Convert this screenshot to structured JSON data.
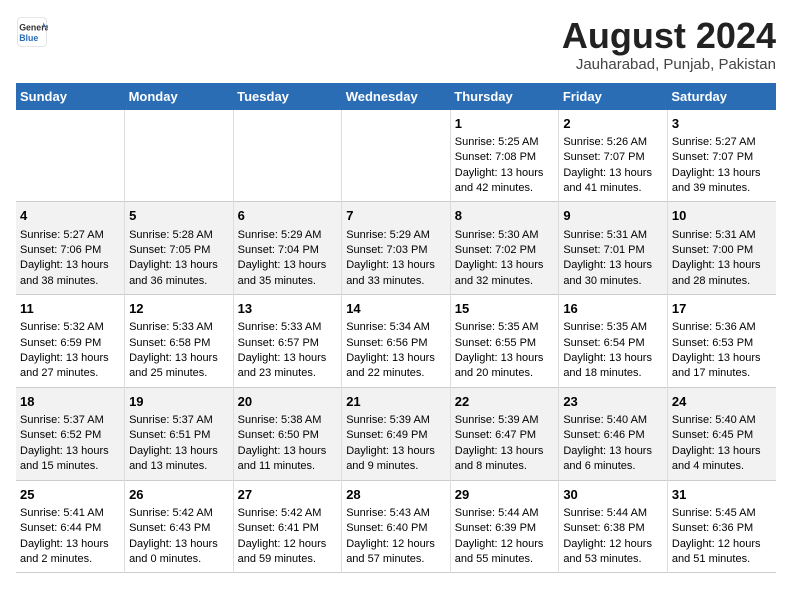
{
  "header": {
    "logo_line1": "General",
    "logo_line2": "Blue",
    "month_title": "August 2024",
    "subtitle": "Jauharabad, Punjab, Pakistan"
  },
  "days_of_week": [
    "Sunday",
    "Monday",
    "Tuesday",
    "Wednesday",
    "Thursday",
    "Friday",
    "Saturday"
  ],
  "weeks": [
    [
      {
        "day": "",
        "lines": []
      },
      {
        "day": "",
        "lines": []
      },
      {
        "day": "",
        "lines": []
      },
      {
        "day": "",
        "lines": []
      },
      {
        "day": "1",
        "lines": [
          "Sunrise: 5:25 AM",
          "Sunset: 7:08 PM",
          "Daylight: 13 hours",
          "and 42 minutes."
        ]
      },
      {
        "day": "2",
        "lines": [
          "Sunrise: 5:26 AM",
          "Sunset: 7:07 PM",
          "Daylight: 13 hours",
          "and 41 minutes."
        ]
      },
      {
        "day": "3",
        "lines": [
          "Sunrise: 5:27 AM",
          "Sunset: 7:07 PM",
          "Daylight: 13 hours",
          "and 39 minutes."
        ]
      }
    ],
    [
      {
        "day": "4",
        "lines": [
          "Sunrise: 5:27 AM",
          "Sunset: 7:06 PM",
          "Daylight: 13 hours",
          "and 38 minutes."
        ]
      },
      {
        "day": "5",
        "lines": [
          "Sunrise: 5:28 AM",
          "Sunset: 7:05 PM",
          "Daylight: 13 hours",
          "and 36 minutes."
        ]
      },
      {
        "day": "6",
        "lines": [
          "Sunrise: 5:29 AM",
          "Sunset: 7:04 PM",
          "Daylight: 13 hours",
          "and 35 minutes."
        ]
      },
      {
        "day": "7",
        "lines": [
          "Sunrise: 5:29 AM",
          "Sunset: 7:03 PM",
          "Daylight: 13 hours",
          "and 33 minutes."
        ]
      },
      {
        "day": "8",
        "lines": [
          "Sunrise: 5:30 AM",
          "Sunset: 7:02 PM",
          "Daylight: 13 hours",
          "and 32 minutes."
        ]
      },
      {
        "day": "9",
        "lines": [
          "Sunrise: 5:31 AM",
          "Sunset: 7:01 PM",
          "Daylight: 13 hours",
          "and 30 minutes."
        ]
      },
      {
        "day": "10",
        "lines": [
          "Sunrise: 5:31 AM",
          "Sunset: 7:00 PM",
          "Daylight: 13 hours",
          "and 28 minutes."
        ]
      }
    ],
    [
      {
        "day": "11",
        "lines": [
          "Sunrise: 5:32 AM",
          "Sunset: 6:59 PM",
          "Daylight: 13 hours",
          "and 27 minutes."
        ]
      },
      {
        "day": "12",
        "lines": [
          "Sunrise: 5:33 AM",
          "Sunset: 6:58 PM",
          "Daylight: 13 hours",
          "and 25 minutes."
        ]
      },
      {
        "day": "13",
        "lines": [
          "Sunrise: 5:33 AM",
          "Sunset: 6:57 PM",
          "Daylight: 13 hours",
          "and 23 minutes."
        ]
      },
      {
        "day": "14",
        "lines": [
          "Sunrise: 5:34 AM",
          "Sunset: 6:56 PM",
          "Daylight: 13 hours",
          "and 22 minutes."
        ]
      },
      {
        "day": "15",
        "lines": [
          "Sunrise: 5:35 AM",
          "Sunset: 6:55 PM",
          "Daylight: 13 hours",
          "and 20 minutes."
        ]
      },
      {
        "day": "16",
        "lines": [
          "Sunrise: 5:35 AM",
          "Sunset: 6:54 PM",
          "Daylight: 13 hours",
          "and 18 minutes."
        ]
      },
      {
        "day": "17",
        "lines": [
          "Sunrise: 5:36 AM",
          "Sunset: 6:53 PM",
          "Daylight: 13 hours",
          "and 17 minutes."
        ]
      }
    ],
    [
      {
        "day": "18",
        "lines": [
          "Sunrise: 5:37 AM",
          "Sunset: 6:52 PM",
          "Daylight: 13 hours",
          "and 15 minutes."
        ]
      },
      {
        "day": "19",
        "lines": [
          "Sunrise: 5:37 AM",
          "Sunset: 6:51 PM",
          "Daylight: 13 hours",
          "and 13 minutes."
        ]
      },
      {
        "day": "20",
        "lines": [
          "Sunrise: 5:38 AM",
          "Sunset: 6:50 PM",
          "Daylight: 13 hours",
          "and 11 minutes."
        ]
      },
      {
        "day": "21",
        "lines": [
          "Sunrise: 5:39 AM",
          "Sunset: 6:49 PM",
          "Daylight: 13 hours",
          "and 9 minutes."
        ]
      },
      {
        "day": "22",
        "lines": [
          "Sunrise: 5:39 AM",
          "Sunset: 6:47 PM",
          "Daylight: 13 hours",
          "and 8 minutes."
        ]
      },
      {
        "day": "23",
        "lines": [
          "Sunrise: 5:40 AM",
          "Sunset: 6:46 PM",
          "Daylight: 13 hours",
          "and 6 minutes."
        ]
      },
      {
        "day": "24",
        "lines": [
          "Sunrise: 5:40 AM",
          "Sunset: 6:45 PM",
          "Daylight: 13 hours",
          "and 4 minutes."
        ]
      }
    ],
    [
      {
        "day": "25",
        "lines": [
          "Sunrise: 5:41 AM",
          "Sunset: 6:44 PM",
          "Daylight: 13 hours",
          "and 2 minutes."
        ]
      },
      {
        "day": "26",
        "lines": [
          "Sunrise: 5:42 AM",
          "Sunset: 6:43 PM",
          "Daylight: 13 hours",
          "and 0 minutes."
        ]
      },
      {
        "day": "27",
        "lines": [
          "Sunrise: 5:42 AM",
          "Sunset: 6:41 PM",
          "Daylight: 12 hours",
          "and 59 minutes."
        ]
      },
      {
        "day": "28",
        "lines": [
          "Sunrise: 5:43 AM",
          "Sunset: 6:40 PM",
          "Daylight: 12 hours",
          "and 57 minutes."
        ]
      },
      {
        "day": "29",
        "lines": [
          "Sunrise: 5:44 AM",
          "Sunset: 6:39 PM",
          "Daylight: 12 hours",
          "and 55 minutes."
        ]
      },
      {
        "day": "30",
        "lines": [
          "Sunrise: 5:44 AM",
          "Sunset: 6:38 PM",
          "Daylight: 12 hours",
          "and 53 minutes."
        ]
      },
      {
        "day": "31",
        "lines": [
          "Sunrise: 5:45 AM",
          "Sunset: 6:36 PM",
          "Daylight: 12 hours",
          "and 51 minutes."
        ]
      }
    ]
  ]
}
